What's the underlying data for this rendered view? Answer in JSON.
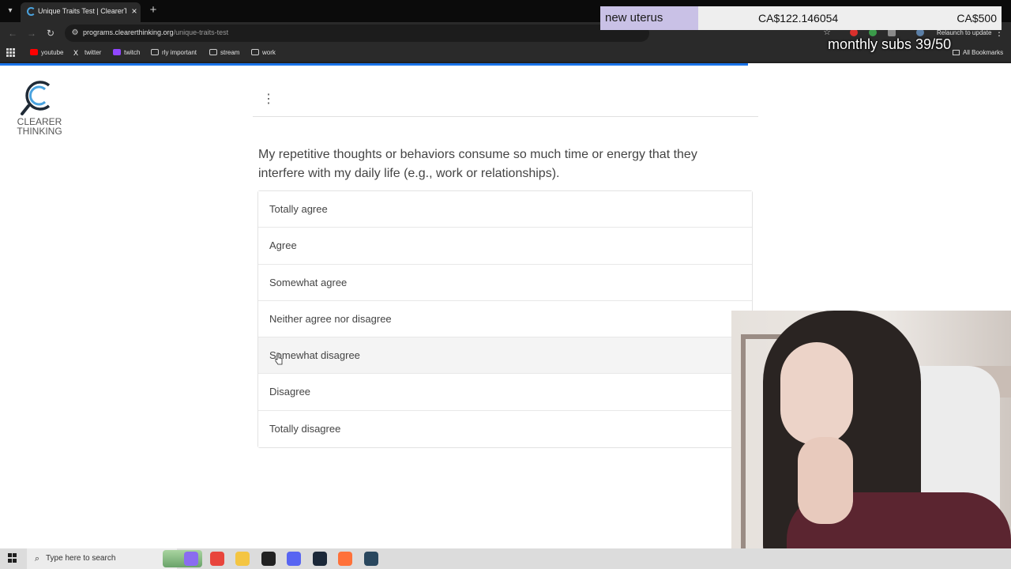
{
  "browser": {
    "tab_title": "Unique Traits Test | ClearerThinking",
    "url_domain": "programs.clearerthinking.org",
    "url_path": "/unique-traits-test",
    "relaunch_label": "Relaunch to update",
    "new_tab_symbol": "+",
    "close_symbol": "×",
    "bookmarks": [
      {
        "label": "youtube",
        "icon": "youtube-icon",
        "color": "#ff0000"
      },
      {
        "label": "twitter",
        "icon": "x-icon",
        "color": "#ffffff"
      },
      {
        "label": "twitch",
        "icon": "twitch-icon",
        "color": "#9146ff"
      },
      {
        "label": "rly important",
        "icon": "folder-icon",
        "color": "#cfcfcf"
      },
      {
        "label": "stream",
        "icon": "folder-icon",
        "color": "#cfcfcf"
      },
      {
        "label": "work",
        "icon": "folder-icon",
        "color": "#cfcfcf"
      }
    ],
    "all_bookmarks_label": "All Bookmarks",
    "page_load_progress": 0.74
  },
  "overlay": {
    "goal_name": "new uterus",
    "goal_amount": "CA$122.146054",
    "goal_target": "CA$500",
    "goal_progress": 0.244,
    "subs_text": "monthly subs 39/50"
  },
  "page": {
    "logo_text_1": "CLEARER",
    "logo_text_2": "THINKING",
    "accent_color": "#1a73e8",
    "question": "My repetitive thoughts or behaviors consume so much time or energy that they interfere with my daily life (e.g., work or relationships).",
    "options": [
      {
        "label": "Totally agree"
      },
      {
        "label": "Agree"
      },
      {
        "label": "Somewhat agree"
      },
      {
        "label": "Neither agree nor disagree"
      },
      {
        "label": "Somewhat disagree"
      },
      {
        "label": "Disagree"
      },
      {
        "label": "Totally disagree"
      }
    ],
    "hovered_option_index": 4
  },
  "taskbar": {
    "search_placeholder": "Type here to search",
    "apps": [
      {
        "icon": "copilot-icon",
        "color": "#8a6cf0"
      },
      {
        "icon": "chrome-icon",
        "color": "#e8453c"
      },
      {
        "icon": "file-explorer-icon",
        "color": "#f4c542"
      },
      {
        "icon": "app-icon",
        "color": "#222222"
      },
      {
        "icon": "discord-icon",
        "color": "#5865f2"
      },
      {
        "icon": "steam-icon",
        "color": "#1b2838"
      },
      {
        "icon": "firefox-icon",
        "color": "#ff7139"
      },
      {
        "icon": "steam-icon",
        "color": "#2a475e"
      }
    ]
  }
}
